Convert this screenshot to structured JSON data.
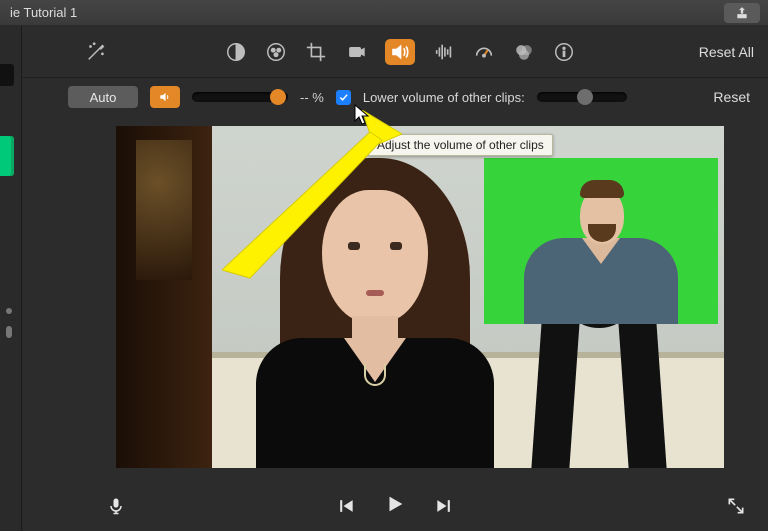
{
  "window": {
    "title": "ie Tutorial 1"
  },
  "toolbar": {
    "reset_all_label": "Reset All",
    "icons": {
      "enhance": "enhance-icon",
      "color_balance": "color-balance-icon",
      "color_wheel": "color-wheel-icon",
      "crop": "crop-icon",
      "stabilize": "stabilize-icon",
      "volume": "volume-icon",
      "noise": "noise-reduction-icon",
      "speed": "speed-icon",
      "effects": "effects-icon",
      "info": "info-icon"
    }
  },
  "volume_panel": {
    "auto_label": "Auto",
    "percent_text": "-- %",
    "lower_label": "Lower volume of other clips:",
    "lower_checked": true,
    "reset_label": "Reset",
    "tooltip_text": "Adjust the volume of other clips"
  },
  "colors": {
    "accent": "#e38727",
    "checkbox": "#1b7fff",
    "annotation": "#fff200"
  },
  "annotation": {
    "present": true,
    "points_to": "lower-volume-checkbox"
  },
  "transport": {
    "icons": {
      "mic": "microphone-icon",
      "prev": "skip-back-icon",
      "play": "play-icon",
      "next": "skip-forward-icon",
      "fullscreen": "fullscreen-icon"
    }
  }
}
